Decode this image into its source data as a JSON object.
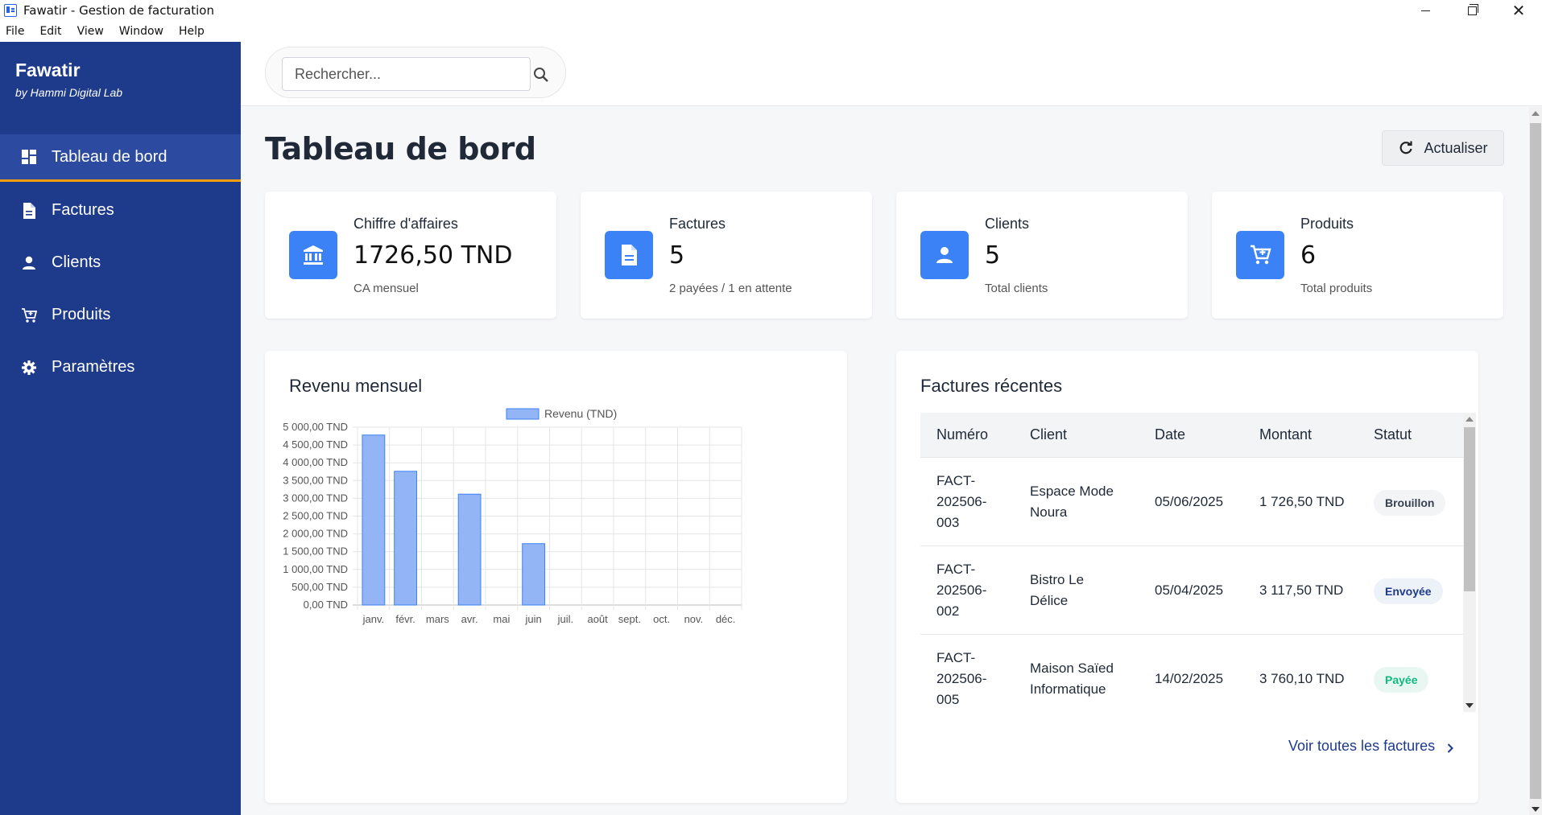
{
  "window": {
    "title": "Fawatir - Gestion de facturation",
    "controls": [
      "minimize-icon",
      "maximize-icon",
      "close-icon"
    ]
  },
  "menu": [
    "File",
    "Edit",
    "View",
    "Window",
    "Help"
  ],
  "sidebar": {
    "brand": "Fawatir",
    "byline": "by Hammi Digital Lab",
    "items": [
      {
        "label": "Tableau de bord",
        "icon": "dashboard-icon",
        "active": true
      },
      {
        "label": "Factures",
        "icon": "document-icon",
        "active": false
      },
      {
        "label": "Clients",
        "icon": "person-icon",
        "active": false
      },
      {
        "label": "Produits",
        "icon": "cart-icon",
        "active": false
      },
      {
        "label": "Paramètres",
        "icon": "gear-icon",
        "active": false
      }
    ],
    "colors": {
      "background": "#1e3a8a",
      "active": "#2b4aa0",
      "accent": "#f59e0b"
    }
  },
  "search": {
    "placeholder": "Rechercher...",
    "value": ""
  },
  "page": {
    "title": "Tableau de bord",
    "refresh_label": "Actualiser"
  },
  "stats": [
    {
      "label": "Chiffre d'affaires",
      "value": "1726,50 TND",
      "sub": "CA mensuel",
      "icon": "bank-icon"
    },
    {
      "label": "Factures",
      "value": "5",
      "sub": "2 payées / 1 en attente",
      "icon": "document-icon"
    },
    {
      "label": "Clients",
      "value": "5",
      "sub": "Total clients",
      "icon": "person-icon"
    },
    {
      "label": "Produits",
      "value": "6",
      "sub": "Total produits",
      "icon": "cart-icon"
    }
  ],
  "revenue_panel": {
    "title": "Revenu mensuel"
  },
  "chart_data": {
    "type": "bar",
    "title": "",
    "legend": "top",
    "categories": [
      "janv.",
      "févr.",
      "mars",
      "avr.",
      "mai",
      "juin",
      "juil.",
      "août",
      "sept.",
      "oct.",
      "nov.",
      "déc."
    ],
    "series": [
      {
        "name": "Revenu (TND)",
        "values": [
          4780,
          3760.1,
          0,
          3117.5,
          0,
          1726.5,
          0,
          0,
          0,
          0,
          0,
          0
        ],
        "color": "#93b4f5",
        "border": "#3b82f6"
      }
    ],
    "yticks": [
      "0,00 TND",
      "500,00 TND",
      "1 000,00 TND",
      "1 500,00 TND",
      "2 000,00 TND",
      "2 500,00 TND",
      "3 000,00 TND",
      "3 500,00 TND",
      "4 000,00 TND",
      "4 500,00 TND",
      "5 000,00 TND"
    ],
    "ylim": [
      0,
      5000
    ],
    "grid": true
  },
  "recent_panel": {
    "title": "Factures récentes",
    "columns": [
      "Numéro",
      "Client",
      "Date",
      "Montant",
      "Statut"
    ],
    "rows": [
      {
        "number": [
          "FACT-",
          "202506-",
          "003"
        ],
        "client": [
          "Espace Mode",
          "Noura"
        ],
        "date": "05/06/2025",
        "amount": "1 726,50 TND",
        "status": "Brouillon",
        "status_kind": "brouillon"
      },
      {
        "number": [
          "FACT-",
          "202506-",
          "002"
        ],
        "client": [
          "Bistro Le",
          "Délice"
        ],
        "date": "05/04/2025",
        "amount": "3 117,50 TND",
        "status": "Envoyée",
        "status_kind": "envoyee"
      },
      {
        "number": [
          "FACT-",
          "202506-",
          "005"
        ],
        "client": [
          "Maison Saïed",
          "Informatique"
        ],
        "date": "14/02/2025",
        "amount": "3 760,10 TND",
        "status": "Payée",
        "status_kind": "payee"
      }
    ],
    "see_all_label": "Voir toutes les factures"
  }
}
